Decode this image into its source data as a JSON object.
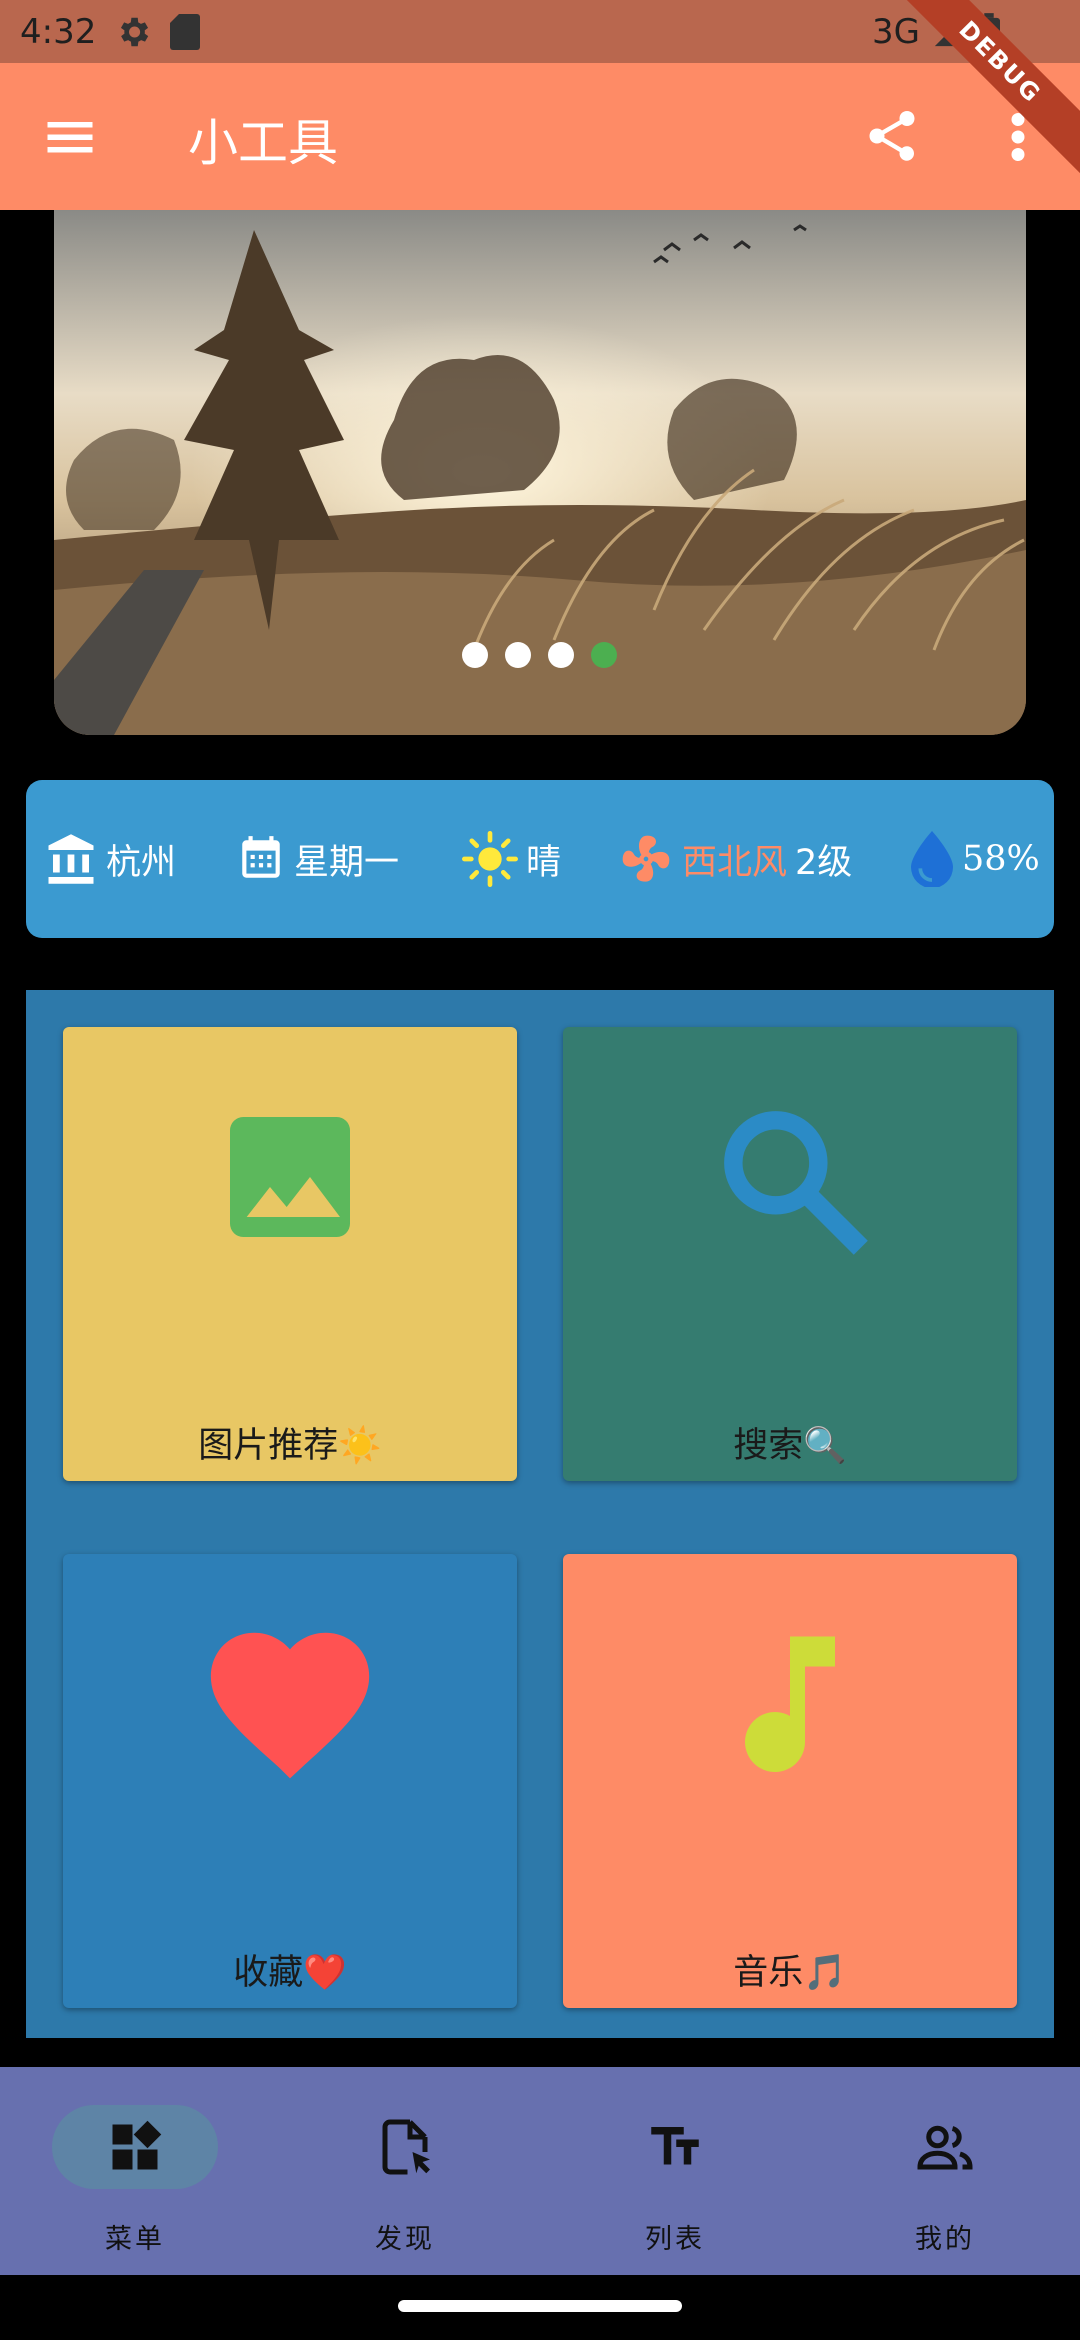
{
  "status_bar": {
    "time": "4:32",
    "network": "3G",
    "debug_label": "DEBUG"
  },
  "app_bar": {
    "title": "小工具"
  },
  "banner": {
    "dots_total": 4,
    "active_dot_index": 3
  },
  "weather": {
    "city": "杭州",
    "weekday": "星期一",
    "condition": "晴",
    "wind_direction": "西北风",
    "wind_level": "2级",
    "humidity": "58%"
  },
  "tiles": [
    {
      "label": "图片推荐☀️",
      "icon": "image-icon",
      "bg": "#e8c764"
    },
    {
      "label": "搜索🔍",
      "icon": "search-icon",
      "bg": "#357c70"
    },
    {
      "label": "收藏❤️",
      "icon": "heart-icon",
      "bg": "#2d7fb7"
    },
    {
      "label": "音乐🎵",
      "icon": "music-note-icon",
      "bg": "#fe8b66"
    }
  ],
  "bottom_nav": {
    "items": [
      {
        "label": "菜单",
        "icon": "dashboard-icon",
        "selected": true
      },
      {
        "label": "发现",
        "icon": "document-cursor-icon",
        "selected": false
      },
      {
        "label": "列表",
        "icon": "text-fields-icon",
        "selected": false
      },
      {
        "label": "我的",
        "icon": "people-icon",
        "selected": false
      }
    ]
  },
  "colors": {
    "primary": "#fe8b66",
    "status_bar": "#b9674e",
    "weather_card": "#3b9ad0",
    "grid_bg": "#2d79aa",
    "nav_bg": "#6770af",
    "active_dot": "#4caf50"
  }
}
